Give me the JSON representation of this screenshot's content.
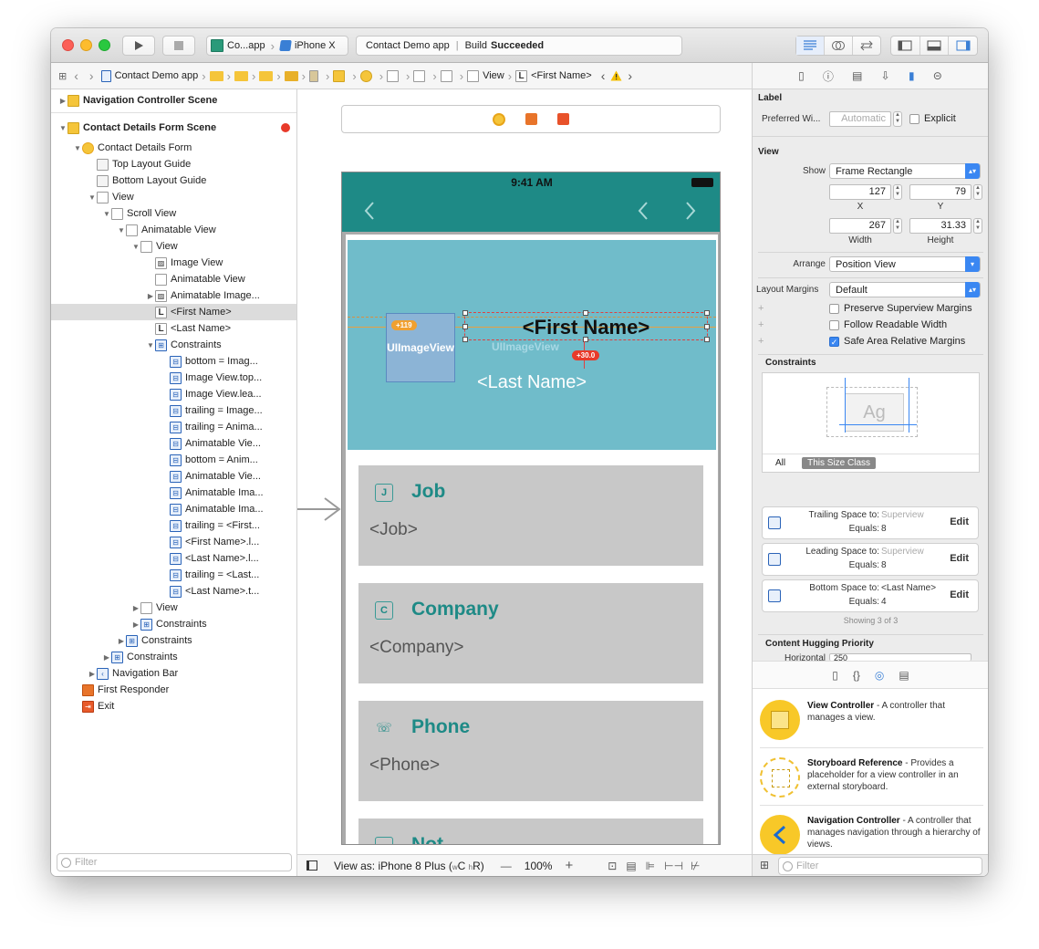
{
  "toolbar": {
    "scheme_app": "Co...app",
    "scheme_device": "iPhone X",
    "status_app": "Contact Demo app",
    "status_sep": "|",
    "status_build": "Build",
    "status_result": "Succeeded"
  },
  "jumpbar": {
    "project": "Contact Demo app",
    "view": "View",
    "label": "<First Name>"
  },
  "outline": {
    "rows": [
      {
        "label": "Navigation Controller Scene"
      },
      {
        "label": "Contact Details Form Scene"
      },
      {
        "label": "Contact Details Form"
      },
      {
        "label": "Top Layout Guide"
      },
      {
        "label": "Bottom Layout Guide"
      },
      {
        "label": "View"
      },
      {
        "label": "Scroll View"
      },
      {
        "label": "Animatable View"
      },
      {
        "label": "View"
      },
      {
        "label": "Image View"
      },
      {
        "label": "Animatable View"
      },
      {
        "label": "Animatable Image..."
      },
      {
        "label": "<First Name>"
      },
      {
        "label": "<Last Name>"
      },
      {
        "label": "Constraints"
      },
      {
        "label": "bottom = Imag..."
      },
      {
        "label": "Image View.top..."
      },
      {
        "label": "Image View.lea..."
      },
      {
        "label": "trailing = Image..."
      },
      {
        "label": "trailing = Anima..."
      },
      {
        "label": "Animatable Vie..."
      },
      {
        "label": "bottom = Anim..."
      },
      {
        "label": "Animatable Vie..."
      },
      {
        "label": "Animatable Ima..."
      },
      {
        "label": "Animatable Ima..."
      },
      {
        "label": "trailing = <First..."
      },
      {
        "label": "<First Name>.l..."
      },
      {
        "label": "<Last Name>.l..."
      },
      {
        "label": "trailing = <Last..."
      },
      {
        "label": "<Last Name>.t..."
      },
      {
        "label": "View"
      },
      {
        "label": "Constraints"
      },
      {
        "label": "Constraints"
      },
      {
        "label": "Constraints"
      },
      {
        "label": "Navigation Bar"
      },
      {
        "label": "First Responder"
      },
      {
        "label": "Exit"
      }
    ],
    "filter_placeholder": "Filter"
  },
  "phone": {
    "time": "9:41 AM",
    "first_name": "<First Name>",
    "last_name": "<Last Name>",
    "image_view_1": "UIImageView",
    "image_view_2": "UIImageView",
    "badge_left": "+119",
    "badge_bottom": "+30.0",
    "fields": [
      {
        "icon": "J",
        "title": "Job",
        "value": "<Job>"
      },
      {
        "icon": "C",
        "title": "Company",
        "value": "<Company>"
      },
      {
        "icon": "☏",
        "title": "Phone",
        "value": "<Phone>"
      },
      {
        "icon": "",
        "title": "Not",
        "value": ""
      }
    ]
  },
  "bottom_bar": {
    "view_as": "View as: iPhone 8 Plus (",
    "size_w": "w",
    "size_c": "C",
    "size_h": "h",
    "size_r": "R)",
    "zoom": "100%",
    "minus": "—",
    "plus": "+"
  },
  "inspector": {
    "label_section": "Label",
    "preferred_width": "Preferred Wi...",
    "preferred_placeholder": "Automatic",
    "explicit": "Explicit",
    "view_section": "View",
    "show_label": "Show",
    "show_value": "Frame Rectangle",
    "x": "127",
    "y": "79",
    "x_label": "X",
    "y_label": "Y",
    "width": "267",
    "height": "31.33",
    "width_label": "Width",
    "height_label": "Height",
    "arrange_label": "Arrange",
    "arrange_value": "Position View",
    "margins_label": "Layout Margins",
    "margins_value": "Default",
    "preserve": "Preserve Superview Margins",
    "follow": "Follow Readable Width",
    "safe_area": "Safe Area Relative Margins",
    "constraints_section": "Constraints",
    "ag": "Ag",
    "tab_all": "All",
    "tab_size_class": "This Size Class",
    "constraints": [
      {
        "title": "Trailing Space to:",
        "target": "Superview",
        "equals": "Equals:",
        "value": "8",
        "edit": "Edit"
      },
      {
        "title": "Leading Space to:",
        "target": "Superview",
        "equals": "Equals:",
        "value": "8",
        "edit": "Edit"
      },
      {
        "title": "Bottom Space to:",
        "target": "<Last Name>",
        "equals": "Equals:",
        "value": "4",
        "edit": "Edit"
      }
    ],
    "showing": "Showing 3 of 3",
    "hugging_section": "Content Hugging Priority",
    "horizontal": "Horizontal",
    "horizontal_value": "250"
  },
  "library": {
    "items": [
      {
        "name": "View Controller",
        "desc": " - A controller that manages a view."
      },
      {
        "name": "Storyboard Reference",
        "desc": " - Provides a placeholder for a view controller in an external storyboard."
      },
      {
        "name": "Navigation Controller",
        "desc": " - A controller that manages navigation through a hierarchy of views."
      }
    ],
    "filter_placeholder": "Filter"
  },
  "colors": {
    "teal_bar": "#1e8a86",
    "header_bg": "#70bcca",
    "field_title": "#1e8a86",
    "accent_blue": "#3a87f2"
  }
}
